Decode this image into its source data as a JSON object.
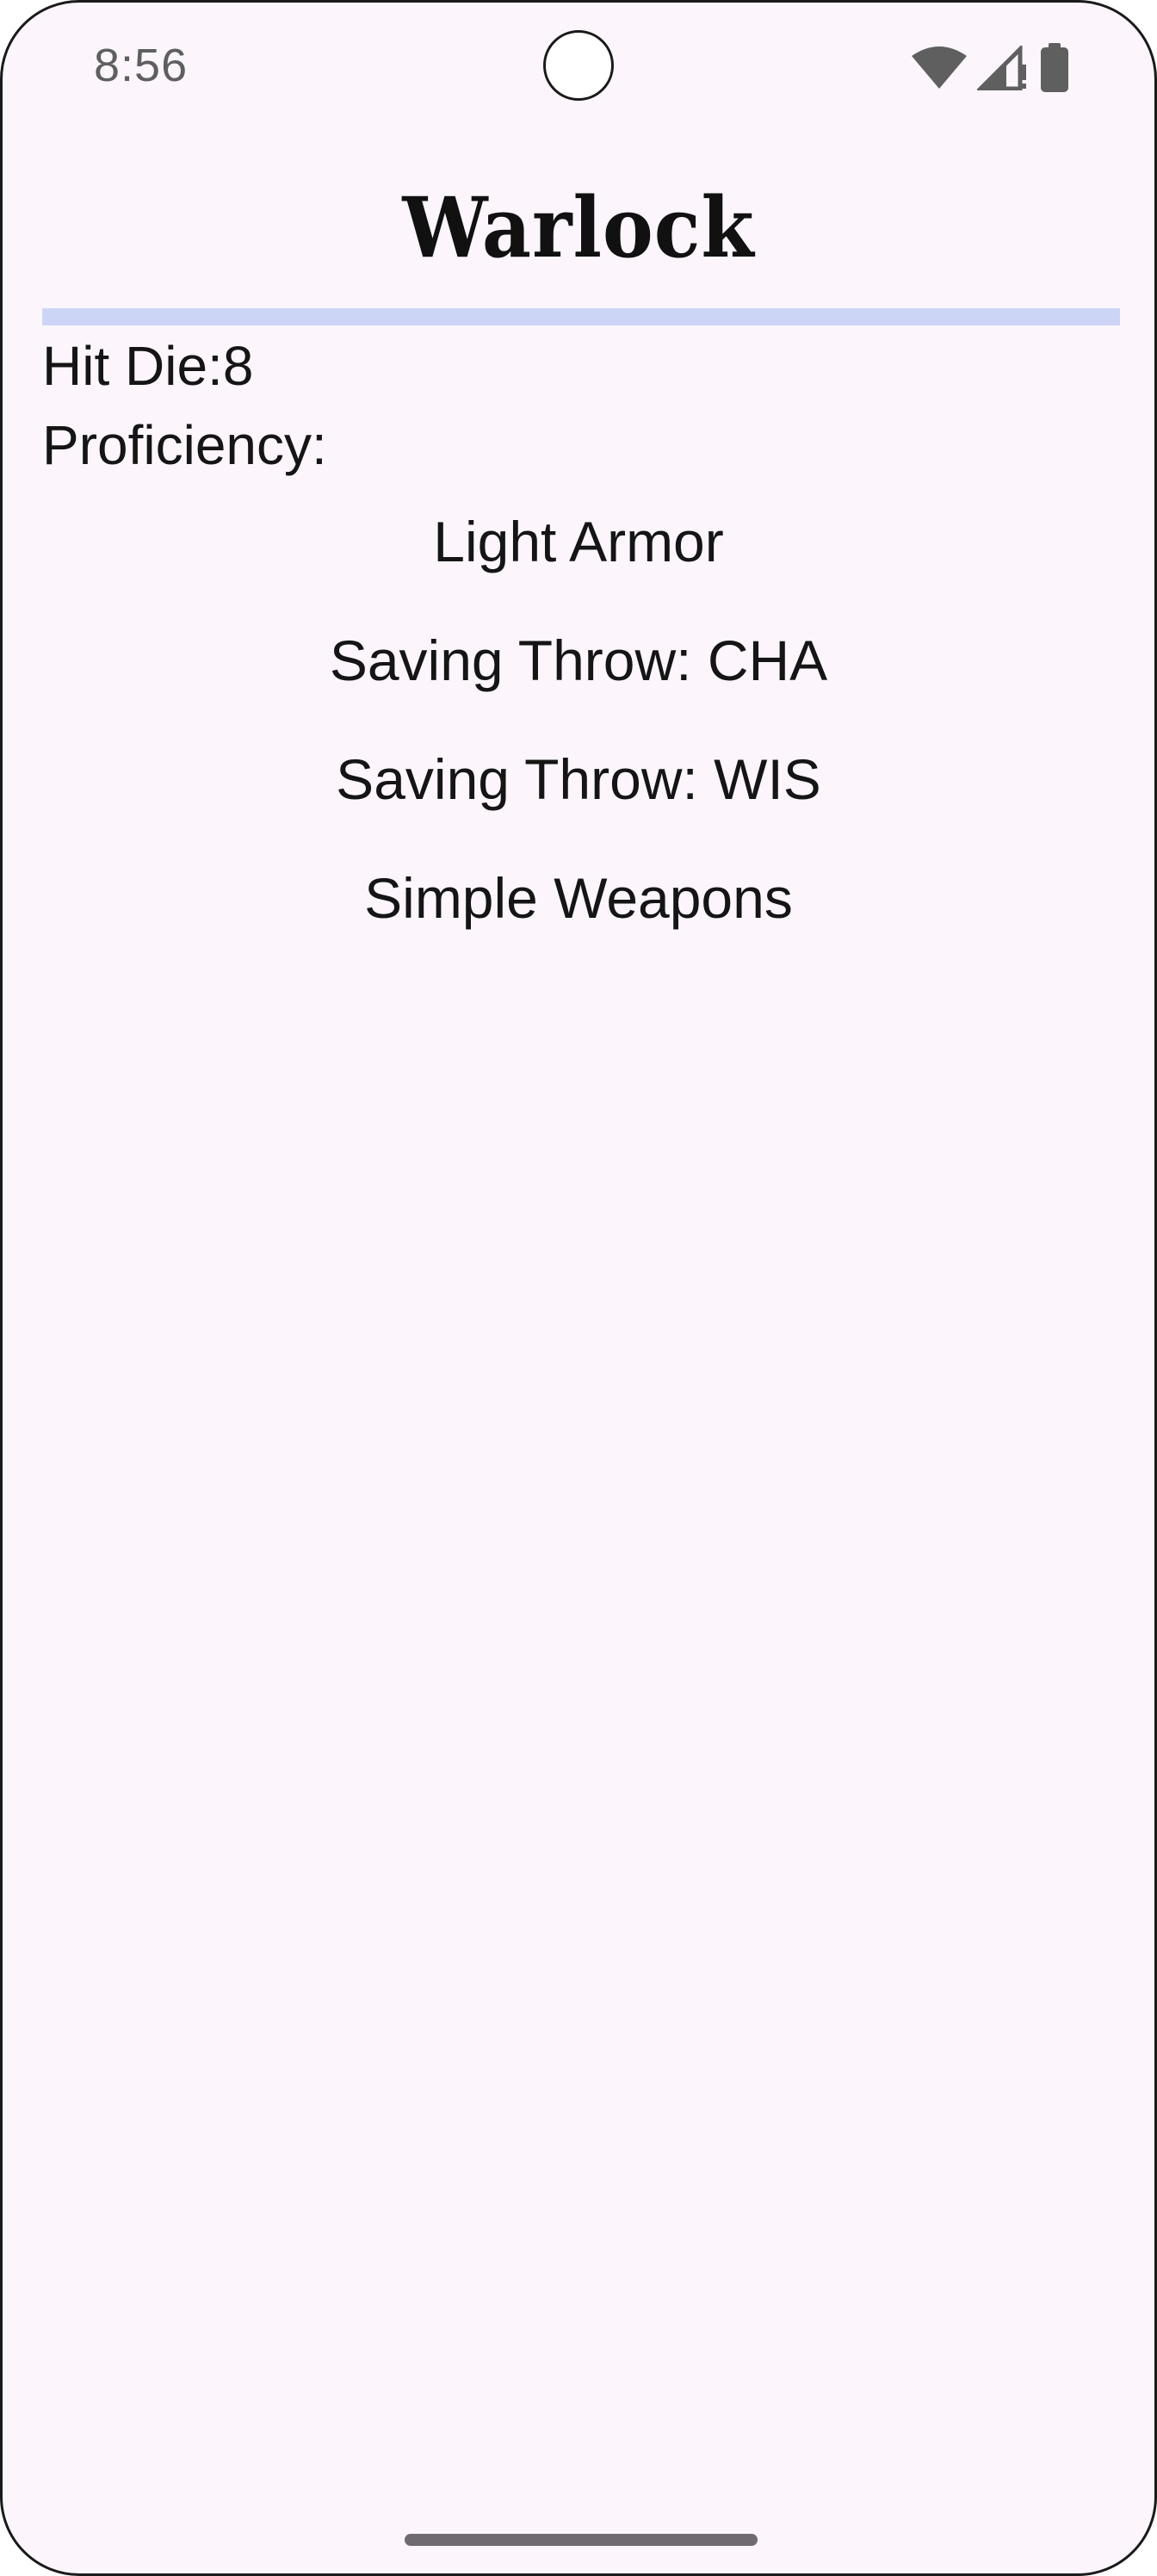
{
  "status_bar": {
    "time": "8:56",
    "icons": [
      "wifi-icon",
      "signal-icon",
      "battery-icon"
    ]
  },
  "class_title": "Warlock",
  "hit_die": {
    "label": "Hit Die:",
    "value": "8"
  },
  "proficiency_label": "Proficiency:",
  "proficiencies": [
    "Light Armor",
    "Saving Throw: CHA",
    "Saving Throw: WIS",
    "Simple Weapons"
  ],
  "colors": {
    "background": "#fcf6fc",
    "divider": "#cdd5f7",
    "text": "#151515"
  }
}
